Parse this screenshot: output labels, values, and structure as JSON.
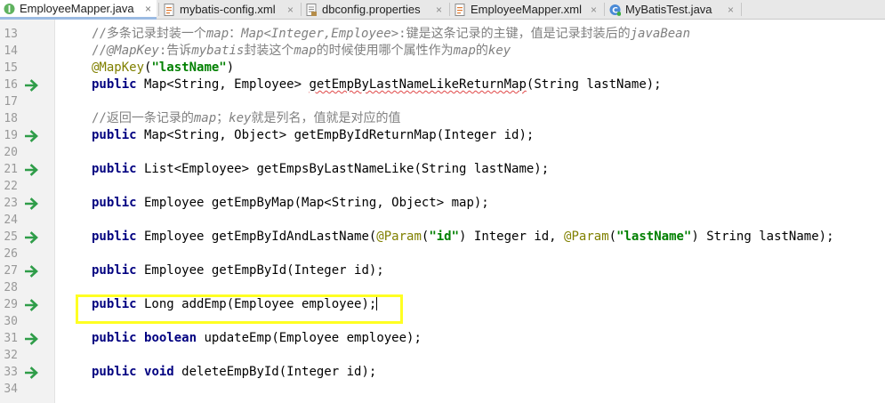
{
  "tabs": [
    {
      "label": "EmployeeMapper.java",
      "icon": "interface-file-icon",
      "active": true
    },
    {
      "label": "mybatis-config.xml",
      "icon": "xml-file-icon",
      "active": false
    },
    {
      "label": "dbconfig.properties",
      "icon": "properties-file-icon",
      "active": false
    },
    {
      "label": "EmployeeMapper.xml",
      "icon": "xml-file-icon",
      "active": false
    },
    {
      "label": "MyBatisTest.java",
      "icon": "class-file-icon",
      "active": false
    }
  ],
  "close_glyph": "×",
  "line_numbers": [
    "13",
    "14",
    "15",
    "16",
    "17",
    "18",
    "19",
    "20",
    "21",
    "22",
    "23",
    "24",
    "25",
    "26",
    "27",
    "28",
    "29",
    "30",
    "31",
    "32",
    "33",
    "34"
  ],
  "gutter_arrow_lines": [
    "16",
    "19",
    "21",
    "23",
    "25",
    "27",
    "29",
    "31",
    "33"
  ],
  "code": {
    "l13": {
      "c1": "//多条记录封装一个",
      "c2": "map",
      "c3": "：",
      "c4": "Map<Integer,Employee>",
      "c5": ":键是这条记录的主键，值是记录封装后的",
      "c6": "javaBean"
    },
    "l14": {
      "c1": "//",
      "c2": "@MapKey",
      "c3": ":告诉",
      "c4": "mybatis",
      "c5": "封装这个",
      "c6": "map",
      "c7": "的时候使用哪个属性作为",
      "c8": "map",
      "c9": "的",
      "c10": "key"
    },
    "l15": {
      "ann": "@MapKey",
      "p1": "(",
      "str": "\"lastName\"",
      "p2": ")"
    },
    "l16": {
      "kw": "public",
      "rest1": " Map<String, Employee> ",
      "method": "getEmpByLastNameLikeReturnMap",
      "rest2": "(String lastName);"
    },
    "l18": {
      "c1": "//返回一条记录的",
      "c2": "map",
      "c3": "；",
      "c4": "key",
      "c5": "就是列名，值就是对应的值"
    },
    "l19": {
      "kw": "public",
      "rest": " Map<String, Object> getEmpByIdReturnMap(Integer id);"
    },
    "l21": {
      "kw": "public",
      "rest": " List<Employee> getEmpsByLastNameLike(String lastName);"
    },
    "l23": {
      "kw": "public",
      "rest": " Employee getEmpByMap(Map<String, Object> map);"
    },
    "l25": {
      "kw": "public",
      "r1": " Employee getEmpByIdAndLastName(",
      "a1": "@Param",
      "p1": "(",
      "s1": "\"id\"",
      "r2": ") Integer id, ",
      "a2": "@Param",
      "p2": "(",
      "s2": "\"lastName\"",
      "r3": ") String lastName);"
    },
    "l27": {
      "kw": "public",
      "rest": " Employee getEmpById(Integer id);"
    },
    "l29": {
      "kw": "public",
      "rest": " Long addEmp(Employee employee);"
    },
    "l31": {
      "kw": "public",
      "kw2": "boolean",
      "rest": " updateEmp(Employee employee);"
    },
    "l33": {
      "kw": "public",
      "kw2": "void",
      "rest": " deleteEmpById(Integer id);"
    }
  },
  "colors": {
    "keyword": "#000080",
    "comment": "#808080",
    "annotation": "#808000",
    "string": "#008000",
    "arrow": "#2f9d49",
    "highlight_box": "#ffff22"
  }
}
